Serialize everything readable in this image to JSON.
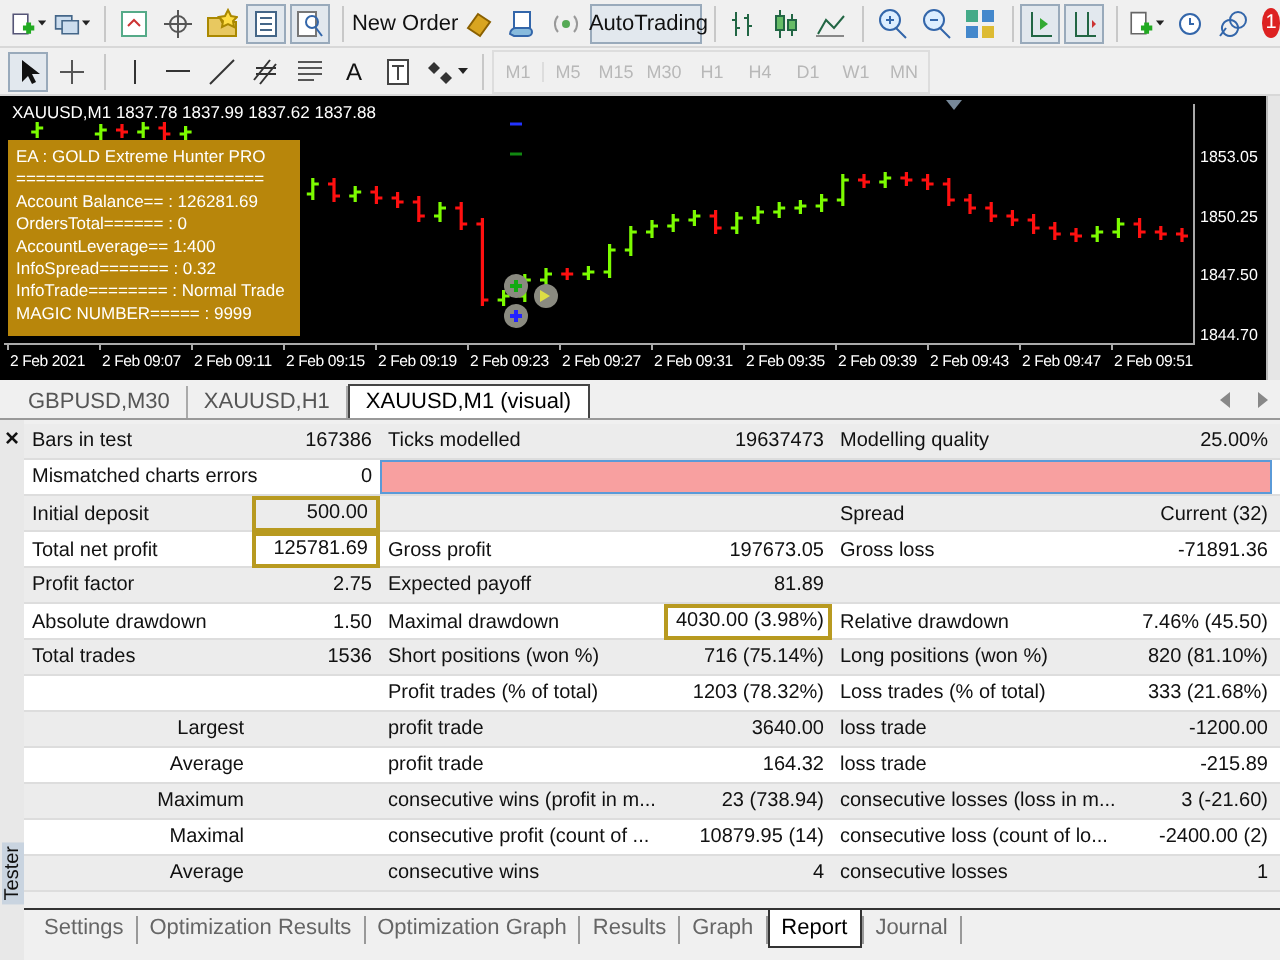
{
  "toolbar": {
    "new_order": "New Order",
    "autotrading": "AutoTrading",
    "notification_count": "1",
    "text_tool": "A"
  },
  "timeframes": [
    {
      "label": "M1",
      "disabled": true
    },
    {
      "label": "M5",
      "disabled": true
    },
    {
      "label": "M15",
      "disabled": true
    },
    {
      "label": "M30",
      "disabled": true
    },
    {
      "label": "H1",
      "disabled": true
    },
    {
      "label": "H4",
      "disabled": true
    },
    {
      "label": "D1",
      "disabled": true
    },
    {
      "label": "W1",
      "disabled": true
    },
    {
      "label": "MN",
      "disabled": true
    }
  ],
  "chart": {
    "title": "XAUUSD,M1  1837.78 1837.99 1837.62 1837.88",
    "info_panel": [
      "EA : GOLD Extreme Hunter PRO",
      "=========================",
      "Account Balance== : 126281.69",
      "OrdersTotal====== : 0",
      "AccountLeverage== 1:400",
      "InfoSpread======= : 0.32",
      "InfoTrade======== : Normal Trade",
      "MAGIC NUMBER===== : 9999"
    ],
    "price_ticks": [
      "1853.05",
      "1850.25",
      "1847.50",
      "1844.70"
    ],
    "time_labels": [
      "2 Feb 2021",
      "2 Feb 09:07",
      "2 Feb 09:11",
      "2 Feb 09:15",
      "2 Feb 09:19",
      "2 Feb 09:23",
      "2 Feb 09:27",
      "2 Feb 09:31",
      "2 Feb 09:35",
      "2 Feb 09:39",
      "2 Feb 09:43",
      "2 Feb 09:47",
      "2 Feb 09:51"
    ]
  },
  "chart_tabs": [
    {
      "label": "GBPUSD,M30",
      "selected": false
    },
    {
      "label": "XAUUSD,H1",
      "selected": false
    },
    {
      "label": "XAUUSD,M1 (visual)",
      "selected": true
    }
  ],
  "report": {
    "close_mark": "×",
    "rows": [
      {
        "kind": "plain",
        "label_1": "Bars in test",
        "value_1": "167386",
        "label_2": "Ticks modelled",
        "value_2": "19637473",
        "label_3": "Modelling quality",
        "value_3": "25.00%"
      },
      {
        "kind": "quality",
        "label_1": "Mismatched charts errors",
        "value_1": "0"
      },
      {
        "kind": "plain",
        "label_1": "Initial deposit",
        "value_1": "500.00",
        "boxed_value_1": true,
        "label_3": "Spread",
        "value_3": "Current (32)"
      },
      {
        "kind": "plain",
        "label_1": "Total net profit",
        "value_1": "125781.69",
        "boxed_value_1": true,
        "label_2": "Gross profit",
        "value_2": "197673.05",
        "label_3": "Gross loss",
        "value_3": "-71891.36"
      },
      {
        "kind": "plain",
        "label_1": "Profit factor",
        "value_1": "2.75",
        "label_2": "Expected payoff",
        "value_2": "81.89"
      },
      {
        "kind": "plain",
        "label_1": "Absolute drawdown",
        "value_1": "1.50",
        "label_2": "Maximal drawdown",
        "value_2": "4030.00 (3.98%)",
        "boxed_value_2": true,
        "label_3": "Relative drawdown",
        "value_3": "7.46% (45.50)"
      },
      {
        "kind": "plain",
        "label_1": "Total trades",
        "value_1": "1536",
        "label_2": "Short positions (won %)",
        "value_2": "716 (75.14%)",
        "label_3": "Long positions (won %)",
        "value_3": "820 (81.10%)"
      },
      {
        "kind": "detail",
        "label_2": "Profit trades (% of total)",
        "value_2": "1203 (78.32%)",
        "label_3": "Loss trades (% of total)",
        "value_3": "333 (21.68%)"
      },
      {
        "kind": "detail",
        "label_1": "Largest",
        "label_2": "profit trade",
        "value_2": "3640.00",
        "label_3": "loss trade",
        "value_3": "-1200.00"
      },
      {
        "kind": "detail",
        "label_1": "Average",
        "label_2": "profit trade",
        "value_2": "164.32",
        "label_3": "loss trade",
        "value_3": "-215.89"
      },
      {
        "kind": "detail",
        "label_1": "Maximum",
        "label_2": "consecutive wins (profit in m...",
        "value_2": "23 (738.94)",
        "label_3": "consecutive losses (loss in m...",
        "value_3": "3 (-21.60)"
      },
      {
        "kind": "detail",
        "label_1": "Maximal",
        "label_2": "consecutive profit (count of ...",
        "value_2": "10879.95 (14)",
        "label_3": "consecutive loss (count of lo...",
        "value_3": "-2400.00 (2)"
      },
      {
        "kind": "detail",
        "label_1": "Average",
        "label_2": "consecutive wins",
        "value_2": "4",
        "label_3": "consecutive losses",
        "value_3": "1"
      }
    ]
  },
  "side_label": "Tester",
  "bottom_tabs": [
    {
      "label": "Settings",
      "selected": false
    },
    {
      "label": "Optimization Results",
      "selected": false
    },
    {
      "label": "Optimization Graph",
      "selected": false
    },
    {
      "label": "Results",
      "selected": false
    },
    {
      "label": "Graph",
      "selected": false
    },
    {
      "label": "Report",
      "selected": true
    },
    {
      "label": "Journal",
      "selected": false
    }
  ]
}
